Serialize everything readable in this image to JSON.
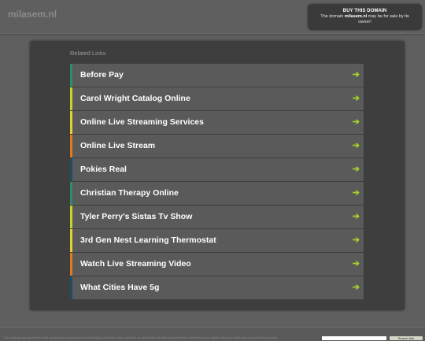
{
  "header": {
    "site_name": "milasem.nl",
    "buy_box": {
      "title": "BUY THIS DOMAIN",
      "text_before": "The domain ",
      "domain": "milasem.nl",
      "text_after": " may be for sale by its owner!"
    }
  },
  "related": {
    "title": "Related Links",
    "items": [
      {
        "label": "Before Pay",
        "accent": "#2e8b6e"
      },
      {
        "label": "Carol Wright Catalog Online",
        "accent": "#c8d32a"
      },
      {
        "label": "Online Live Streaming Services",
        "accent": "#e2d12c"
      },
      {
        "label": "Online Live Stream",
        "accent": "#e07a1e"
      },
      {
        "label": "Pokies Real",
        "accent": "#1f4f5e"
      },
      {
        "label": "Christian Therapy Online",
        "accent": "#2e8b6e"
      },
      {
        "label": "Tyler Perry's Sistas Tv Show",
        "accent": "#c8d32a"
      },
      {
        "label": "3rd Gen Nest Learning Thermostat",
        "accent": "#e2d12c"
      },
      {
        "label": "Watch Live Streaming Video",
        "accent": "#e07a1e"
      },
      {
        "label": "What Cities Have 5g",
        "accent": "#1f4f5e"
      }
    ],
    "arrow_icon": "arrow-right-icon",
    "arrow_glyph": "➔",
    "arrow_color": "#a5d02a"
  },
  "footer": {
    "disclaimer": "This webpage was generated by the domain owner using Sedo Domain Parking. Disclaimer: Sedo maintains no relationship with third party advertisers. Reference to any specific service or trade mark is not controlled by Sedo",
    "search_button": "Search Ads"
  },
  "colors": {
    "page_bg": "#5f5f5f",
    "panel_bg": "#3e3e3e",
    "link_bg": "#5a5a5a",
    "buy_box_bg": "#3a3a3a"
  }
}
